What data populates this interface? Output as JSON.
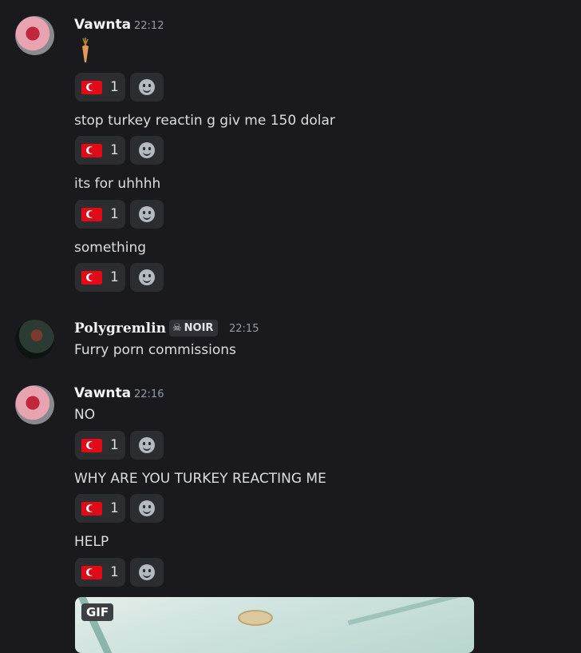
{
  "messages": [
    {
      "author": "Vawnta",
      "time": "22:12",
      "lines": [
        {
          "text": "",
          "sticker": "carrot-icon",
          "reaction_count": "1"
        },
        {
          "text": "stop turkey reactin g giv me 150 dolar",
          "reaction_count": "1"
        },
        {
          "text": "its for uhhhh",
          "reaction_count": "1"
        },
        {
          "text": "something",
          "reaction_count": "1"
        }
      ]
    },
    {
      "author": "Polygremlin",
      "badge": "NOIR",
      "time": "22:15",
      "lines": [
        {
          "text": "Furry porn commissions"
        }
      ]
    },
    {
      "author": "Vawnta",
      "time": "22:16",
      "lines": [
        {
          "text": "NO",
          "reaction_count": "1"
        },
        {
          "text": "WHY ARE YOU TURKEY REACTING ME",
          "reaction_count": "1"
        },
        {
          "text": "HELP",
          "reaction_count": "1"
        }
      ],
      "gif_label": "GIF"
    }
  ],
  "icons": {
    "reaction_emoji": "turkey-flag-icon",
    "add_reaction": "add-reaction-icon",
    "badge_icon": "skull-icon"
  },
  "colors": {
    "background": "#1a1a1e",
    "reaction_bg": "#2b2d31",
    "flag_red": "#e30a17"
  }
}
